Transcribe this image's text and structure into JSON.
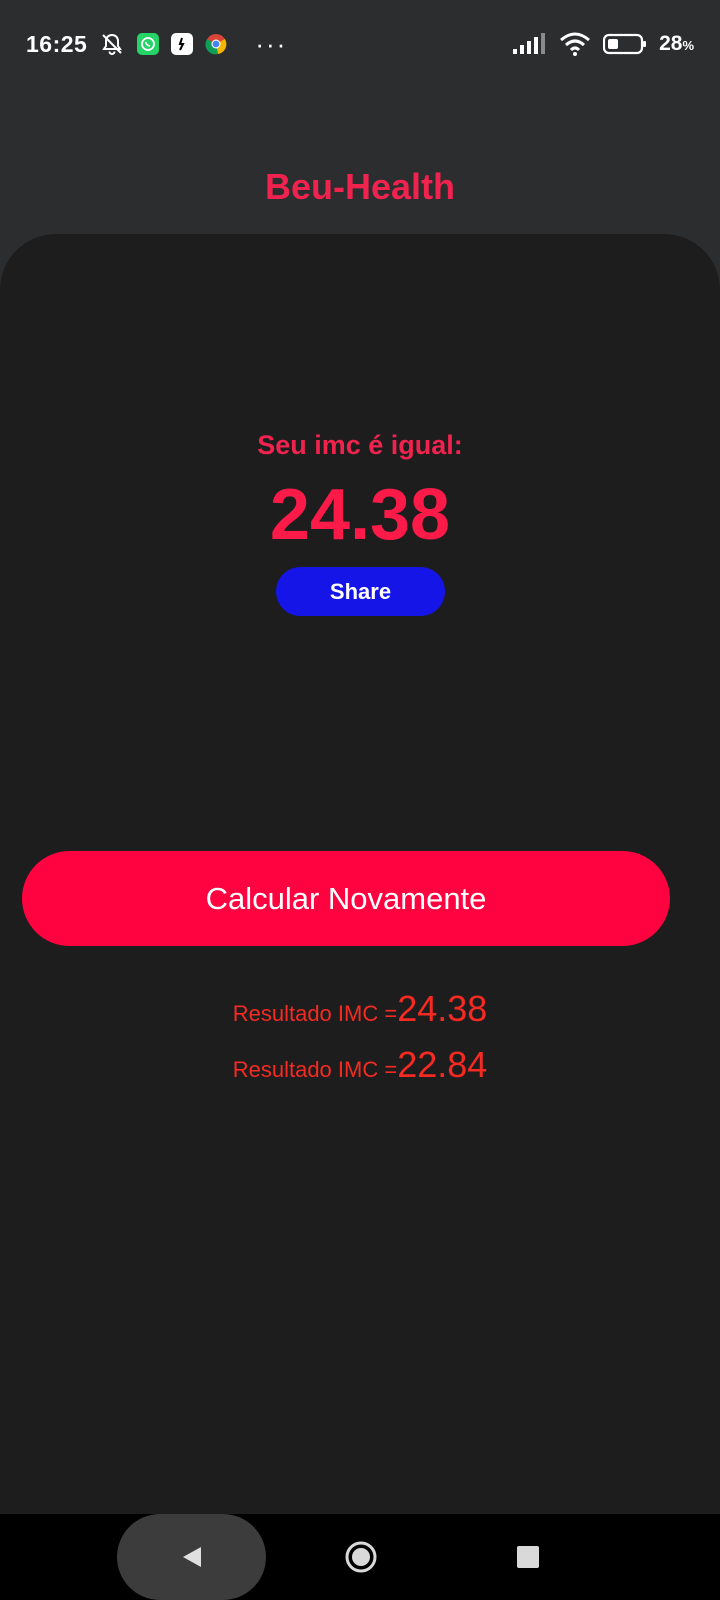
{
  "status_bar": {
    "time": "16:25",
    "notification_icons": [
      "muted-bell-icon",
      "whatsapp-icon",
      "app-icon",
      "chrome-icon"
    ],
    "more_indicator": "···",
    "battery_percent": "28",
    "battery_unit": "%"
  },
  "app": {
    "title": "Beu-Health"
  },
  "result": {
    "label": "Seu imc é igual:",
    "value": "24.38",
    "share_label": "Share"
  },
  "actions": {
    "recalculate_label": "Calcular Novamente"
  },
  "history": [
    {
      "prefix": "Resultado IMC =",
      "value": "24.38"
    },
    {
      "prefix": "Resultado IMC =",
      "value": "22.84"
    }
  ],
  "colors": {
    "accent": "#f0224e",
    "button_primary": "#ff0240",
    "share_button": "#1515e8",
    "history_text": "#f52a22",
    "card_bg": "#1d1d1e",
    "screen_bg": "#2b2d2f"
  }
}
